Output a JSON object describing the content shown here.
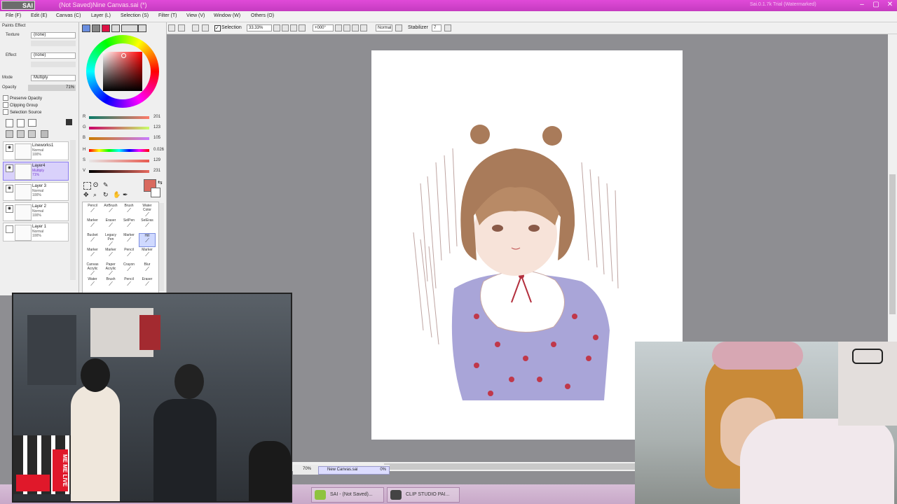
{
  "window": {
    "app_logo": "SAI",
    "title": "(Not Saved)Nine Canvas.sai (*)",
    "right_text": "Sai.0.1.7k Trial (Watermarked)"
  },
  "menu": [
    "File (F)",
    "Edit (E)",
    "Canvas (C)",
    "Layer (L)",
    "Selection (S)",
    "Filter (T)",
    "View (V)",
    "Window (W)",
    "Others (O)"
  ],
  "toolbar": {
    "selection_label": "Selection",
    "zoom": "33.33%",
    "angle": "+000°",
    "mode": "Normal",
    "stabilizer_label": "Stabilizer",
    "stabilizer_value": "7"
  },
  "left_panel": {
    "paints_effect": "Paints Effect",
    "texture_label": "Texture",
    "texture_value": "(none)",
    "effect_label": "Effect",
    "effect_value": "(none)",
    "mode_label": "Mode",
    "mode_value": "Multiply",
    "opacity_label": "Opacity",
    "opacity_value": "71%",
    "checkboxes": [
      "Preserve Opacity",
      "Clipping Group",
      "Selection Source"
    ],
    "layers": [
      {
        "name": "Lineworks1",
        "mode": "Normal",
        "opacity": "100%"
      },
      {
        "name": "Layer4",
        "mode": "Multiply",
        "opacity": "71%"
      },
      {
        "name": "Layer 3",
        "mode": "Normal",
        "opacity": "100%"
      },
      {
        "name": "Layer 2",
        "mode": "Normal",
        "opacity": "100%"
      },
      {
        "name": "Layer 1",
        "mode": "Normal",
        "opacity": "100%"
      }
    ]
  },
  "color_panel": {
    "sliders": [
      {
        "label": "R",
        "value": "201"
      },
      {
        "label": "G",
        "value": "123"
      },
      {
        "label": "B",
        "value": "105"
      },
      {
        "label": "H",
        "value": "0.026"
      },
      {
        "label": "S",
        "value": "129"
      },
      {
        "label": "V",
        "value": "231"
      }
    ],
    "current_color": "#d96a5f"
  },
  "brushes": [
    [
      "Pencil",
      "AirBrush",
      "Brush",
      "Water Color"
    ],
    [
      "Marker",
      "Eraser",
      "SelPen",
      "SelEras"
    ],
    [
      "Bucket",
      "Legacy Pen",
      "Marker",
      "Hill"
    ],
    [
      "Marker",
      "Marker",
      "Pencil",
      "Marker"
    ],
    [
      "Canvas Acrylic",
      "Paper Acrylic",
      "Crayon",
      "Blur"
    ],
    [
      "Water",
      "Brush",
      "Pencil",
      "Eraser"
    ]
  ],
  "status": {
    "zoom": "70%",
    "doc": "New Canvas.sai",
    "percent": "0%"
  },
  "taskbar": [
    {
      "label": "SAI - (Not Saved)..."
    },
    {
      "label": "CLIP STUDIO PAI..."
    }
  ],
  "overlay": {
    "logo_text": "ME ME LIVE"
  }
}
